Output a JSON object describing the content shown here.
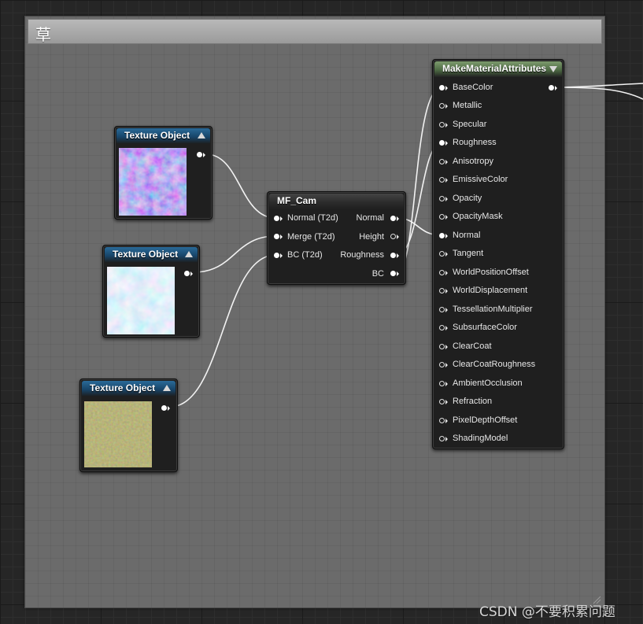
{
  "comment_box": {
    "title": "草"
  },
  "texture_nodes": [
    {
      "title": "Texture Object",
      "thumbnail": "normal-map-blue"
    },
    {
      "title": "Texture Object",
      "thumbnail": "cyan-noise"
    },
    {
      "title": "Texture Object",
      "thumbnail": "olive-grass"
    }
  ],
  "mf_cam": {
    "title": "MF_Cam",
    "inputs": [
      "Normal (T2d)",
      "Merge (T2d)",
      "BC (T2d)"
    ],
    "outputs": [
      "Normal",
      "Height",
      "Roughness",
      "BC"
    ]
  },
  "make_material_attributes": {
    "title": "MakeMaterialAttributes",
    "inputs": [
      "BaseColor",
      "Metallic",
      "Specular",
      "Roughness",
      "Anisotropy",
      "EmissiveColor",
      "Opacity",
      "OpacityMask",
      "Normal",
      "Tangent",
      "WorldPositionOffset",
      "WorldDisplacement",
      "TessellationMultiplier",
      "SubsurfaceColor",
      "ClearCoat",
      "ClearCoatRoughness",
      "AmbientOcclusion",
      "Refraction",
      "PixelDepthOffset",
      "ShadingModel"
    ]
  },
  "watermark": "CSDN @不要积累问题",
  "colors": {
    "graph_background": "#262626",
    "comment_fill": "#6b6b6b",
    "texture_header": "#1d5a86",
    "material_header": "#5e7d52",
    "wire": "#ffffff"
  }
}
